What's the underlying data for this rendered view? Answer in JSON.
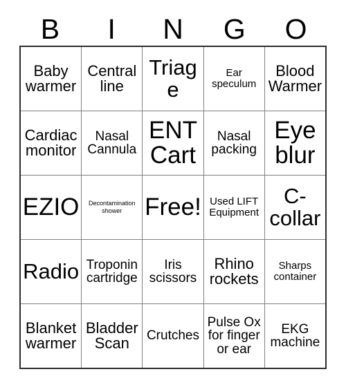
{
  "card": {
    "header_letters": [
      "B",
      "I",
      "N",
      "G",
      "O"
    ],
    "rows": [
      [
        {
          "text": "Baby warmer",
          "size": "s-lg"
        },
        {
          "text": "Central line",
          "size": "s-lg"
        },
        {
          "text": "Triage",
          "size": "s-xxl"
        },
        {
          "text": "Ear speculum",
          "size": "s-sm"
        },
        {
          "text": "Blood Warmer",
          "size": "s-lg"
        }
      ],
      [
        {
          "text": "Cardiac monitor",
          "size": "s-lg"
        },
        {
          "text": "Nasal Cannula",
          "size": "s-md"
        },
        {
          "text": "ENT Cart",
          "size": "s-huge"
        },
        {
          "text": "Nasal packing",
          "size": "s-md"
        },
        {
          "text": "Eye blur",
          "size": "s-huge"
        }
      ],
      [
        {
          "text": "EZIO",
          "size": "s-huge"
        },
        {
          "text": "Decontamination shower",
          "size": "s-xs"
        },
        {
          "text": "Free!",
          "size": "s-huge"
        },
        {
          "text": "Used LIFT Equipment",
          "size": "s-sm"
        },
        {
          "text": "C-collar",
          "size": "s-xxl"
        }
      ],
      [
        {
          "text": "Radio",
          "size": "s-xxl"
        },
        {
          "text": "Troponin cartridge",
          "size": "s-md"
        },
        {
          "text": "Iris scissors",
          "size": "s-md"
        },
        {
          "text": "Rhino rockets",
          "size": "s-lg"
        },
        {
          "text": "Sharps container",
          "size": "s-sm"
        }
      ],
      [
        {
          "text": "Blanket warmer",
          "size": "s-lg"
        },
        {
          "text": "Bladder Scan",
          "size": "s-lg"
        },
        {
          "text": "Crutches",
          "size": "s-md"
        },
        {
          "text": "Pulse Ox for finger or ear",
          "size": "s-md"
        },
        {
          "text": "EKG machine",
          "size": "s-md"
        }
      ]
    ],
    "free_space_label": "Free!",
    "colors": {
      "background": "#ffffff",
      "text": "#000000",
      "cell_border": "#808080",
      "outer_border": "#2b2b2b"
    }
  }
}
